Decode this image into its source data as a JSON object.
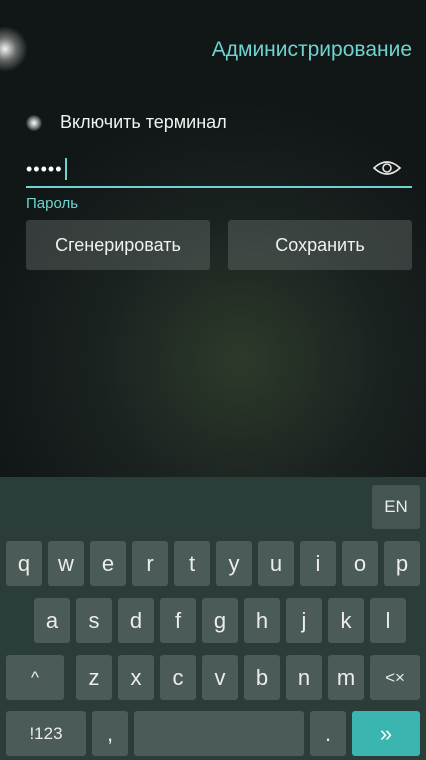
{
  "header": {
    "title": "Администрирование"
  },
  "toggle": {
    "label": "Включить терминал"
  },
  "password": {
    "value": "•••••",
    "hint": "Пароль"
  },
  "buttons": {
    "generate": "Сгенерировать",
    "save": "Сохранить"
  },
  "keyboard": {
    "lang": "EN",
    "row1": [
      "q",
      "w",
      "e",
      "r",
      "t",
      "y",
      "u",
      "i",
      "o",
      "p"
    ],
    "row2": [
      "a",
      "s",
      "d",
      "f",
      "g",
      "h",
      "j",
      "k",
      "l"
    ],
    "row3": {
      "shift": "^",
      "keys": [
        "z",
        "x",
        "c",
        "v",
        "b",
        "n",
        "m"
      ],
      "backspace": "<×"
    },
    "row4": {
      "symbols": "!123",
      "comma": ",",
      "space": "",
      "period": ".",
      "enter": "»"
    }
  },
  "colors": {
    "accent": "#6fd3cf",
    "key": "#4b5b57",
    "action": "#3bb5b0"
  }
}
